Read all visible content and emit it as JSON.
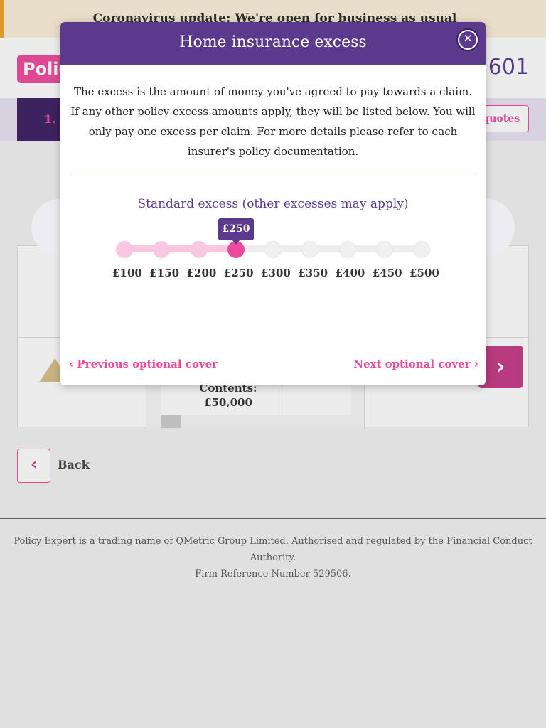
{
  "banner": {
    "text": "Coronavirus update: We're open for business as usual"
  },
  "header": {
    "logo_text": "Polic",
    "phone": "0 601"
  },
  "steps": {
    "current_step": "1.",
    "save_quotes": "e quotes"
  },
  "card": {
    "contents_label": "Contents:",
    "contents_value": "£50,000",
    "next_icon": "›"
  },
  "back": {
    "label": "Back",
    "icon": "‹"
  },
  "footer": {
    "line1": "Policy Expert is a trading name of QMetric Group Limited. Authorised and regulated by the Financial Conduct Authority.",
    "line2": "Firm Reference Number 529506."
  },
  "modal": {
    "title": "Home insurance excess",
    "close_icon": "close-icon",
    "description": "The excess is the amount of money you've agreed to pay towards a claim. If any other policy excess amounts apply, they will be listed below. You will only pay one excess per claim. For more details please refer to each insurer's policy documentation.",
    "slider_title": "Standard excess (other excesses may apply)",
    "selected_value": "£250",
    "selected_index": 3,
    "options": [
      "£100",
      "£150",
      "£200",
      "£250",
      "£300",
      "£350",
      "£400",
      "£450",
      "£500"
    ],
    "prev_arrow": "‹",
    "next_arrow": "›",
    "prev_link": "Previous optional cover",
    "next_link": "Next optional cover",
    "prev_chevron": "‹",
    "next_chevron": "›"
  },
  "colors": {
    "brand_purple": "#5b3a8e",
    "brand_pink": "#ee4a9b",
    "fill_pink": "#f9c7df"
  }
}
